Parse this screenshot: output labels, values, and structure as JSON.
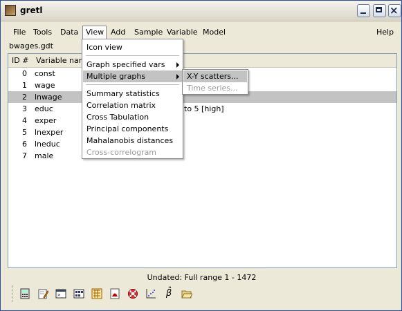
{
  "window": {
    "title": "gretl"
  },
  "menubar": [
    {
      "label": "File"
    },
    {
      "label": "Tools"
    },
    {
      "label": "Data"
    },
    {
      "label": "View"
    },
    {
      "label": "Add"
    },
    {
      "label": "Sample"
    },
    {
      "label": "Variable"
    },
    {
      "label": "Model"
    },
    {
      "label": "Help"
    }
  ],
  "dataset": {
    "filename": "bwages.gdt"
  },
  "table": {
    "headers": [
      "ID #",
      "Variable name"
    ],
    "rows": [
      {
        "id": "0",
        "name": "const"
      },
      {
        "id": "1",
        "name": "wage"
      },
      {
        "id": "2",
        "name": "lnwage",
        "selected": true
      },
      {
        "id": "3",
        "name": "educ",
        "desc_fragment": "to 5 [high]"
      },
      {
        "id": "4",
        "name": "exper"
      },
      {
        "id": "5",
        "name": "lnexper"
      },
      {
        "id": "6",
        "name": "lneduc"
      },
      {
        "id": "7",
        "name": "male"
      }
    ]
  },
  "view_menu": {
    "items": [
      {
        "label": "Icon view"
      },
      {
        "label": "Graph specified vars",
        "submenu": true
      },
      {
        "label": "Multiple graphs",
        "submenu": true,
        "highlight": true
      },
      {
        "label": "Summary statistics"
      },
      {
        "label": "Correlation matrix"
      },
      {
        "label": "Cross Tabulation"
      },
      {
        "label": "Principal components"
      },
      {
        "label": "Mahalanobis distances"
      },
      {
        "label": "Cross-correlogram",
        "disabled": true
      }
    ]
  },
  "multiple_graphs_submenu": {
    "items": [
      {
        "label": "X-Y scatters...",
        "highlight": true
      },
      {
        "label": "Time series...",
        "disabled": true
      }
    ]
  },
  "status": "Undated: Full range 1 - 1472",
  "toolbar": {
    "icons": [
      "calculator-icon",
      "edit-script-icon",
      "console-icon",
      "session-icon",
      "function-icon",
      "pdf-help-icon",
      "help-lifebuoy-icon",
      "plot-icon",
      "beta-model-icon",
      "open-folder-icon"
    ],
    "beta_glyph": "β̂"
  },
  "colors": {
    "selection": "#c3c3c3",
    "titlebar_border": "#2c4b9d"
  }
}
